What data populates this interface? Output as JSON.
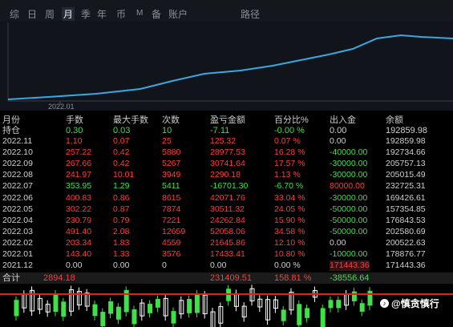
{
  "tabs": [
    {
      "label": "综",
      "active": false
    },
    {
      "label": "日",
      "active": false
    },
    {
      "label": "周",
      "active": false
    },
    {
      "label": "月",
      "active": true
    },
    {
      "label": "季",
      "active": false
    },
    {
      "label": "年",
      "active": false
    },
    {
      "label": "币",
      "active": false
    },
    {
      "label": "M",
      "active": false
    },
    {
      "label": "备",
      "active": false
    },
    {
      "label": "账户",
      "active": false
    },
    {
      "label": "路径",
      "active": false
    }
  ],
  "chart": {
    "x_tick_label": "2022.01",
    "line_color": "#3aa8e0"
  },
  "table": {
    "headers": [
      "月份",
      "手数",
      "最大手数",
      "次数",
      "盈亏金额",
      "百分比%",
      "出入金",
      "余额"
    ],
    "hold": [
      "持仓",
      "0.30",
      "0.03",
      "10",
      "-7.11",
      "-0.00 %",
      "0.00",
      "192859.98"
    ],
    "rows": [
      [
        "2022.11",
        "1.10",
        "0.07",
        "25",
        "125.32",
        "0.07 %",
        "0.00",
        "192859.98"
      ],
      [
        "2022.10",
        "257.22",
        "0.42",
        "5880",
        "28977.53",
        "16.28 %",
        "-40000.00",
        "192734.66"
      ],
      [
        "2022.09",
        "267.66",
        "0.42",
        "5267",
        "30741.64",
        "17.57 %",
        "-30000.00",
        "205757.13"
      ],
      [
        "2022.08",
        "241.97",
        "10.01",
        "3949",
        "2290.18",
        "1.13 %",
        "-30000.00",
        "205015.49"
      ],
      [
        "2022.07",
        "353.95",
        "1.29",
        "5411",
        "-16701.30",
        "-6.70 %",
        "80000.00",
        "232725.31"
      ],
      [
        "2022.06",
        "400.83",
        "0.86",
        "8615",
        "42071.76",
        "33.04 %",
        "-30000.00",
        "169426.61"
      ],
      [
        "2022.05",
        "302.22",
        "0.87",
        "7874",
        "30511.32",
        "24.05 %",
        "-50000.00",
        "157354.85"
      ],
      [
        "2022.04",
        "230.79",
        "0.79",
        "7221",
        "24262.84",
        "15.90 %",
        "-50000.00",
        "176843.53"
      ],
      [
        "2022.03",
        "491.40",
        "2.08",
        "12659",
        "52058.06",
        "34.58 %",
        "-50000.00",
        "202580.69"
      ],
      [
        "2022.02",
        "203.34",
        "1.83",
        "4559",
        "21645.86",
        "12.10 %",
        "0.00",
        "200522.63"
      ],
      [
        "2022.01",
        "143.40",
        "1.33",
        "3576",
        "17433.41",
        "10.80 %",
        "-10000.00",
        "178876.77"
      ],
      [
        "2021.12",
        "0.00",
        "0.00",
        "0",
        "0.00",
        "0.00 %",
        "171443.36",
        "171443.36"
      ]
    ],
    "total": {
      "label": "合计",
      "lots": "2894.18",
      "pnl": "231409.51",
      "percent": "158.81 %",
      "flow": "-38556.64"
    }
  },
  "watermark": {
    "text": "@慎贪慎行",
    "icon": "douyin-icon"
  },
  "colors": {
    "positive": "#ff3b3b",
    "negative": "#40e048",
    "neutral": "#d0d0d0",
    "accent_line": "#e02020"
  }
}
